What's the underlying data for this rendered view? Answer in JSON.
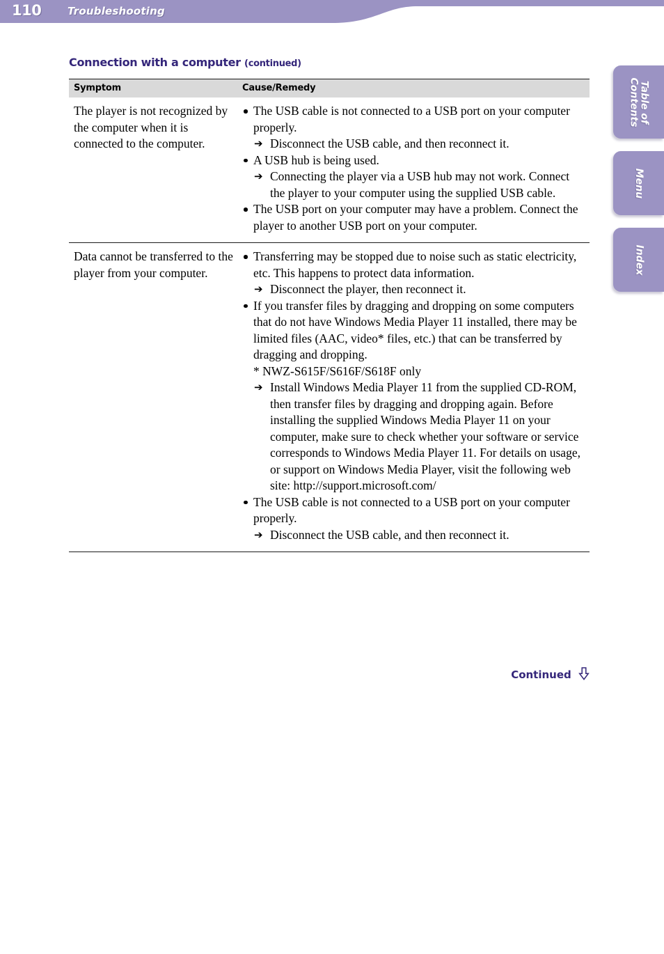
{
  "header": {
    "page_number": "110",
    "title": "Troubleshooting",
    "banner_color": "#9b93c3"
  },
  "side_tabs": [
    {
      "name": "table-of-contents",
      "label": "Table of\nContents",
      "line1": "Table of",
      "line2": "Contents"
    },
    {
      "name": "menu",
      "label": "Menu",
      "line1": "Menu",
      "line2": ""
    },
    {
      "name": "index",
      "label": "Index",
      "line1": "Index",
      "line2": ""
    }
  ],
  "section": {
    "heading": "Connection with a computer",
    "heading_note": "(continued)",
    "heading_color": "#34267a"
  },
  "table": {
    "columns": [
      "Symptom",
      "Cause/Remedy"
    ],
    "rows": [
      {
        "symptom": "The player is not recognized by the computer when it is connected to the computer.",
        "causes": [
          {
            "text": "The USB cable is not connected to a USB port on your computer properly.",
            "remedy": "Disconnect the USB cable, and then reconnect it."
          },
          {
            "text": "A USB hub is being used.",
            "remedy": "Connecting the player via a USB hub may not work. Connect the player to your computer using the supplied USB cable."
          },
          {
            "text": "The USB port on your computer may have a problem. Connect the player to another USB port on your computer.",
            "remedy": ""
          }
        ]
      },
      {
        "symptom": "Data cannot be transferred to the player from your computer.",
        "causes": [
          {
            "text": "Transferring may be stopped due to noise such as static electricity, etc. This happens to protect data information.",
            "remedy": "Disconnect the player, then reconnect it."
          },
          {
            "text": "If you transfer files by dragging and dropping on some computers that do not have Windows Media Player 11 installed, there may be limited files (AAC, video* files, etc.) that can be transferred by dragging and dropping.",
            "footnote": "* NWZ-S615F/S616F/S618F only",
            "remedy": "Install Windows Media Player 11 from the supplied CD-ROM, then transfer files by dragging and dropping again. Before installing the supplied Windows Media Player 11 on your computer, make sure to check whether your software or service corresponds to Windows Media Player 11. For details on usage, or support on Windows Media Player, visit the following web site: http://support.microsoft.com/"
          },
          {
            "text": "The USB cable is not connected to a USB port on your computer properly.",
            "remedy": "Disconnect the USB cable, and then reconnect it."
          }
        ]
      }
    ]
  },
  "footer": {
    "continued_label": "Continued",
    "arrow_icon": "arrow-down-outline-icon"
  },
  "glyphs": {
    "arrow_right": "➔"
  }
}
